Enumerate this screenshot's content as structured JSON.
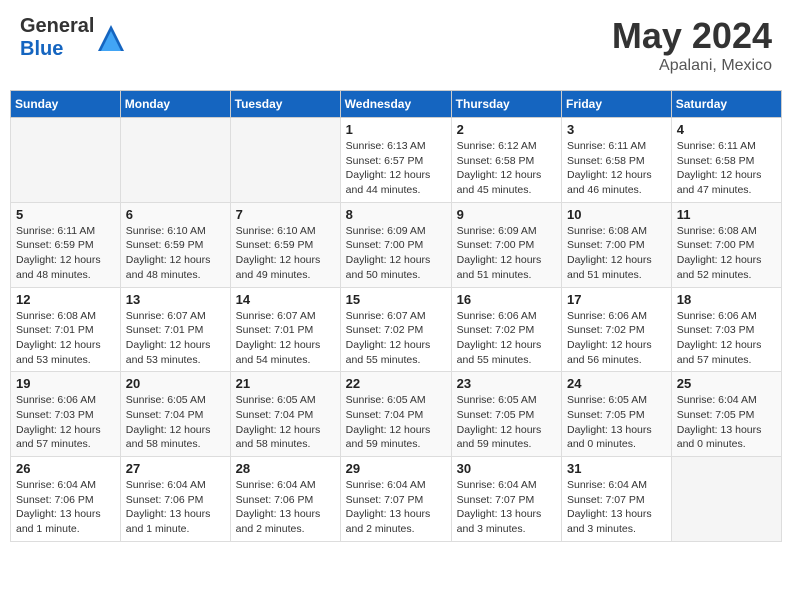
{
  "header": {
    "logo_general": "General",
    "logo_blue": "Blue",
    "title": "May 2024",
    "location": "Apalani, Mexico"
  },
  "days_of_week": [
    "Sunday",
    "Monday",
    "Tuesday",
    "Wednesday",
    "Thursday",
    "Friday",
    "Saturday"
  ],
  "weeks": [
    [
      {
        "day": "",
        "sunrise": "",
        "sunset": "",
        "daylight": ""
      },
      {
        "day": "",
        "sunrise": "",
        "sunset": "",
        "daylight": ""
      },
      {
        "day": "",
        "sunrise": "",
        "sunset": "",
        "daylight": ""
      },
      {
        "day": "1",
        "sunrise": "Sunrise: 6:13 AM",
        "sunset": "Sunset: 6:57 PM",
        "daylight": "Daylight: 12 hours and 44 minutes."
      },
      {
        "day": "2",
        "sunrise": "Sunrise: 6:12 AM",
        "sunset": "Sunset: 6:58 PM",
        "daylight": "Daylight: 12 hours and 45 minutes."
      },
      {
        "day": "3",
        "sunrise": "Sunrise: 6:11 AM",
        "sunset": "Sunset: 6:58 PM",
        "daylight": "Daylight: 12 hours and 46 minutes."
      },
      {
        "day": "4",
        "sunrise": "Sunrise: 6:11 AM",
        "sunset": "Sunset: 6:58 PM",
        "daylight": "Daylight: 12 hours and 47 minutes."
      }
    ],
    [
      {
        "day": "5",
        "sunrise": "Sunrise: 6:11 AM",
        "sunset": "Sunset: 6:59 PM",
        "daylight": "Daylight: 12 hours and 48 minutes."
      },
      {
        "day": "6",
        "sunrise": "Sunrise: 6:10 AM",
        "sunset": "Sunset: 6:59 PM",
        "daylight": "Daylight: 12 hours and 48 minutes."
      },
      {
        "day": "7",
        "sunrise": "Sunrise: 6:10 AM",
        "sunset": "Sunset: 6:59 PM",
        "daylight": "Daylight: 12 hours and 49 minutes."
      },
      {
        "day": "8",
        "sunrise": "Sunrise: 6:09 AM",
        "sunset": "Sunset: 7:00 PM",
        "daylight": "Daylight: 12 hours and 50 minutes."
      },
      {
        "day": "9",
        "sunrise": "Sunrise: 6:09 AM",
        "sunset": "Sunset: 7:00 PM",
        "daylight": "Daylight: 12 hours and 51 minutes."
      },
      {
        "day": "10",
        "sunrise": "Sunrise: 6:08 AM",
        "sunset": "Sunset: 7:00 PM",
        "daylight": "Daylight: 12 hours and 51 minutes."
      },
      {
        "day": "11",
        "sunrise": "Sunrise: 6:08 AM",
        "sunset": "Sunset: 7:00 PM",
        "daylight": "Daylight: 12 hours and 52 minutes."
      }
    ],
    [
      {
        "day": "12",
        "sunrise": "Sunrise: 6:08 AM",
        "sunset": "Sunset: 7:01 PM",
        "daylight": "Daylight: 12 hours and 53 minutes."
      },
      {
        "day": "13",
        "sunrise": "Sunrise: 6:07 AM",
        "sunset": "Sunset: 7:01 PM",
        "daylight": "Daylight: 12 hours and 53 minutes."
      },
      {
        "day": "14",
        "sunrise": "Sunrise: 6:07 AM",
        "sunset": "Sunset: 7:01 PM",
        "daylight": "Daylight: 12 hours and 54 minutes."
      },
      {
        "day": "15",
        "sunrise": "Sunrise: 6:07 AM",
        "sunset": "Sunset: 7:02 PM",
        "daylight": "Daylight: 12 hours and 55 minutes."
      },
      {
        "day": "16",
        "sunrise": "Sunrise: 6:06 AM",
        "sunset": "Sunset: 7:02 PM",
        "daylight": "Daylight: 12 hours and 55 minutes."
      },
      {
        "day": "17",
        "sunrise": "Sunrise: 6:06 AM",
        "sunset": "Sunset: 7:02 PM",
        "daylight": "Daylight: 12 hours and 56 minutes."
      },
      {
        "day": "18",
        "sunrise": "Sunrise: 6:06 AM",
        "sunset": "Sunset: 7:03 PM",
        "daylight": "Daylight: 12 hours and 57 minutes."
      }
    ],
    [
      {
        "day": "19",
        "sunrise": "Sunrise: 6:06 AM",
        "sunset": "Sunset: 7:03 PM",
        "daylight": "Daylight: 12 hours and 57 minutes."
      },
      {
        "day": "20",
        "sunrise": "Sunrise: 6:05 AM",
        "sunset": "Sunset: 7:04 PM",
        "daylight": "Daylight: 12 hours and 58 minutes."
      },
      {
        "day": "21",
        "sunrise": "Sunrise: 6:05 AM",
        "sunset": "Sunset: 7:04 PM",
        "daylight": "Daylight: 12 hours and 58 minutes."
      },
      {
        "day": "22",
        "sunrise": "Sunrise: 6:05 AM",
        "sunset": "Sunset: 7:04 PM",
        "daylight": "Daylight: 12 hours and 59 minutes."
      },
      {
        "day": "23",
        "sunrise": "Sunrise: 6:05 AM",
        "sunset": "Sunset: 7:05 PM",
        "daylight": "Daylight: 12 hours and 59 minutes."
      },
      {
        "day": "24",
        "sunrise": "Sunrise: 6:05 AM",
        "sunset": "Sunset: 7:05 PM",
        "daylight": "Daylight: 13 hours and 0 minutes."
      },
      {
        "day": "25",
        "sunrise": "Sunrise: 6:04 AM",
        "sunset": "Sunset: 7:05 PM",
        "daylight": "Daylight: 13 hours and 0 minutes."
      }
    ],
    [
      {
        "day": "26",
        "sunrise": "Sunrise: 6:04 AM",
        "sunset": "Sunset: 7:06 PM",
        "daylight": "Daylight: 13 hours and 1 minute."
      },
      {
        "day": "27",
        "sunrise": "Sunrise: 6:04 AM",
        "sunset": "Sunset: 7:06 PM",
        "daylight": "Daylight: 13 hours and 1 minute."
      },
      {
        "day": "28",
        "sunrise": "Sunrise: 6:04 AM",
        "sunset": "Sunset: 7:06 PM",
        "daylight": "Daylight: 13 hours and 2 minutes."
      },
      {
        "day": "29",
        "sunrise": "Sunrise: 6:04 AM",
        "sunset": "Sunset: 7:07 PM",
        "daylight": "Daylight: 13 hours and 2 minutes."
      },
      {
        "day": "30",
        "sunrise": "Sunrise: 6:04 AM",
        "sunset": "Sunset: 7:07 PM",
        "daylight": "Daylight: 13 hours and 3 minutes."
      },
      {
        "day": "31",
        "sunrise": "Sunrise: 6:04 AM",
        "sunset": "Sunset: 7:07 PM",
        "daylight": "Daylight: 13 hours and 3 minutes."
      },
      {
        "day": "",
        "sunrise": "",
        "sunset": "",
        "daylight": ""
      }
    ]
  ]
}
